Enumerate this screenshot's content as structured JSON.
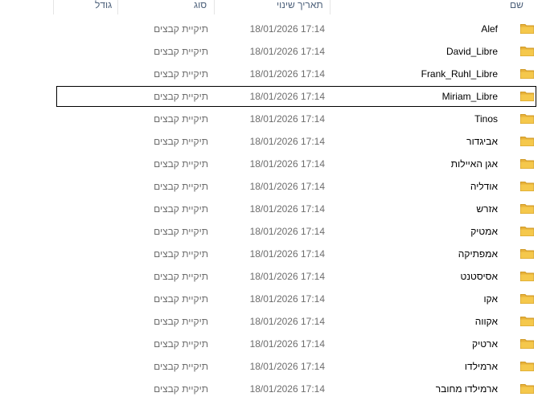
{
  "columns": {
    "name": "שם",
    "modified": "תאריך שינוי",
    "type": "סוג",
    "size": "גודל"
  },
  "icon": "folder-icon",
  "accent": "#f5c84c",
  "focused_index": 3,
  "rows": [
    {
      "name": "Alef",
      "modified": "18/01/2026 17:14",
      "type": "תיקיית קבצים"
    },
    {
      "name": "David_Libre",
      "modified": "18/01/2026 17:14",
      "type": "תיקיית קבצים"
    },
    {
      "name": "Frank_Ruhl_Libre",
      "modified": "18/01/2026 17:14",
      "type": "תיקיית קבצים"
    },
    {
      "name": "Miriam_Libre",
      "modified": "18/01/2026 17:14",
      "type": "תיקיית קבצים"
    },
    {
      "name": "Tinos",
      "modified": "18/01/2026 17:14",
      "type": "תיקיית קבצים"
    },
    {
      "name": "אביגדור",
      "modified": "18/01/2026 17:14",
      "type": "תיקיית קבצים"
    },
    {
      "name": "אגן האיילות",
      "modified": "18/01/2026 17:14",
      "type": "תיקיית קבצים"
    },
    {
      "name": "אודליה",
      "modified": "18/01/2026 17:14",
      "type": "תיקיית קבצים"
    },
    {
      "name": "אזרש",
      "modified": "18/01/2026 17:14",
      "type": "תיקיית קבצים"
    },
    {
      "name": "אמטיק",
      "modified": "18/01/2026 17:14",
      "type": "תיקיית קבצים"
    },
    {
      "name": "אמפתיקה",
      "modified": "18/01/2026 17:14",
      "type": "תיקיית קבצים"
    },
    {
      "name": "אסיסטנט",
      "modified": "18/01/2026 17:14",
      "type": "תיקיית קבצים"
    },
    {
      "name": "אקו",
      "modified": "18/01/2026 17:14",
      "type": "תיקיית קבצים"
    },
    {
      "name": "אקווה",
      "modified": "18/01/2026 17:14",
      "type": "תיקיית קבצים"
    },
    {
      "name": "ארטיק",
      "modified": "18/01/2026 17:14",
      "type": "תיקיית קבצים"
    },
    {
      "name": "ארמילדו",
      "modified": "18/01/2026 17:14",
      "type": "תיקיית קבצים"
    },
    {
      "name": "ארמילדו מחובר",
      "modified": "18/01/2026 17:14",
      "type": "תיקיית קבצים"
    }
  ]
}
